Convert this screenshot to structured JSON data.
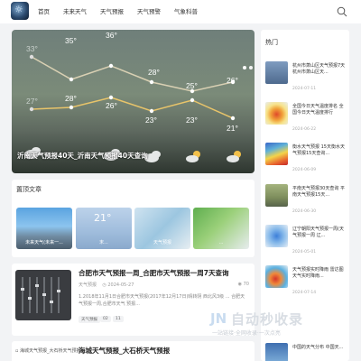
{
  "nav": {
    "items": [
      "首页",
      "未来天气",
      "天气预报",
      "天气预警",
      "气象科普"
    ]
  },
  "hero": {
    "caption": "沂南天气预报40天_沂南天气预报40天查询",
    "high_temps": [
      "33°",
      "35°",
      "36°",
      "28°",
      "25°",
      "26°"
    ],
    "low_temps": [
      "27°",
      "28°",
      "26°",
      "23°",
      "23°",
      "21°"
    ]
  },
  "featured": {
    "title": "置顶文章",
    "items": [
      {
        "label": "未来天气(未来一..."
      },
      {
        "label": "末..."
      },
      {
        "label": "天气预报"
      },
      {
        "label": "..."
      }
    ]
  },
  "article1": {
    "title": "合肥市天气预报一周_合肥市天气预报一周7天查询",
    "category": "天气预报",
    "date": "2024-05-27",
    "views": "70",
    "excerpt": "1.2018年11月1日合肥市天气预报(2017年12月17日)晴转阴 西北风3级 ... 合肥天气预报一周,合肥市天气 预报...",
    "tags": [
      "天气预报",
      "02",
      "11"
    ]
  },
  "article2": {
    "title": "海城天气预报_大石桥天气预报",
    "img_alt": "海城天气预报_大石桥天气预报"
  },
  "sidebar": {
    "title": "热门",
    "items": [
      {
        "text": "杭州市萧山区天气预报7天 杭州市萧山区天...",
        "date": "2024-07-11"
      },
      {
        "text": "全国今日天气温度排名 全国今日天气温度排行",
        "date": "2024-06-22"
      },
      {
        "text": "衡水天气预报 15天衡水天气预报15天查询...",
        "date": "2024-06-09"
      },
      {
        "text": "平南天气预报30天查询 平南天气预报15天...",
        "date": "2024-06-30"
      },
      {
        "text": "辽宁朝阳天气预报一周(天气预报一周 辽...",
        "date": "2024-05-01"
      },
      {
        "text": "天气预报实时降雨 雷达图 天气实时降雨...",
        "date": "2024-07-14"
      },
      {
        "text": "中国的天气分布 中国天...",
        "date": ""
      }
    ]
  },
  "watermark": {
    "text": "自动秒收录",
    "sub": "一站链接·全网收录·一次点亮"
  },
  "colors": {
    "accent": "#2b4a6e",
    "high_line": "#d9d0b3",
    "low_line": "#e8c46a"
  }
}
